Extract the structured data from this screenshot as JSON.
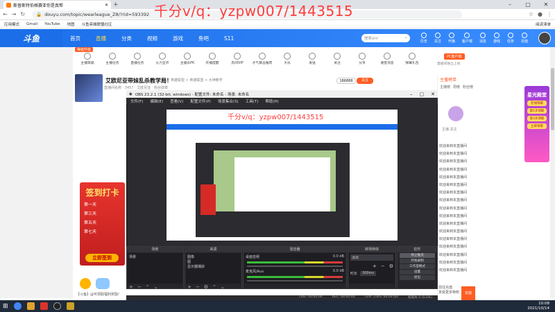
{
  "browser": {
    "tab_title": "斯普斯特伯格赛亚你是真帮",
    "url": "douyu.com/topic/wearleague_Z8/?rid=593392",
    "bookmarks": [
      "应用模式",
      "Gmail",
      "YouTube",
      "地图",
      "斗鱼英雄联盟社区"
    ],
    "bookmarks_right": "阅读清单"
  },
  "watermark": "千分v/q：yzpw007/1443515",
  "douyu_nav": {
    "logo": "斗鱼",
    "items": [
      "首页",
      "直播",
      "分类",
      "视频",
      "游戏",
      "鱼吧",
      "S11"
    ],
    "active_index": 1,
    "search_placeholder": "搜索dnf",
    "top_icons": [
      "历史",
      "关注",
      "开播",
      "客户端",
      "消息",
      "游戏",
      "任务",
      "充值"
    ]
  },
  "player_row": {
    "level_badge": "等级升级",
    "items": [
      "主播等级",
      "主播任务",
      "直播任务",
      "火力全开",
      "主播乐PK",
      "开播提醒",
      "房间VIP",
      "才气暴击推荐",
      "大乐",
      "发送",
      "关注",
      "分享",
      "语音消息",
      "弹幕礼包",
      "更多动态"
    ],
    "pc_button": "PC客户端",
    "pc_sub": "直播间独立上线"
  },
  "room": {
    "title": "艾欧尼亚带妹乱杀教学局！",
    "subtitle": "英雄联盟 > 英雄联盟 > 大神教学",
    "subtitle2": "直播间名称 · 3457 · 艾欧尼亚 · 粉丝勋章",
    "fans": "186888",
    "follow": "关注"
  },
  "right_panel": {
    "header": "主播榜单",
    "tabs": [
      "主播榜",
      "周榜",
      "粉丝榜"
    ],
    "host_caption": "主播 关注",
    "chat": [
      "欢迎来到本直播间",
      "欢迎来到本直播间",
      "欢迎来到本直播间",
      "欢迎来到本直播间",
      "欢迎来到本直播间",
      "欢迎来到本直播间",
      "欢迎来到本直播间",
      "欢迎来到本直播间",
      "欢迎来到本直播间",
      "欢迎来到本直播间",
      "欢迎来到本直播间",
      "欢迎来到本直播间",
      "欢迎来到本直播间",
      "欢迎来到本直播间",
      "欢迎来到本直播间",
      "欢迎来到本直播间",
      "欢迎来到本直播间"
    ],
    "bottom_text": [
      "前往充值",
      "享受更多特权"
    ],
    "bottom_button": "充值"
  },
  "left_ad": {
    "title": "签到打卡",
    "days": [
      "第一天",
      "第三天",
      "第五天",
      "第七天"
    ],
    "button": "立即签到"
  },
  "side_ad": {
    "title": "星光殿堂",
    "items": [
      "在线领取",
      "第1天领取",
      "第3天领取",
      "立即领取"
    ]
  },
  "obs": {
    "title": "OBS 23.2.1 (32-bit, windows) - 配置文件: 未命名 - 场景: 未命名",
    "menu": [
      "文件(F)",
      "编辑(E)",
      "查看(V)",
      "配置文件(P)",
      "场景集合(S)",
      "工具(T)",
      "帮助(H)"
    ],
    "docks": {
      "scenes": {
        "title": "场景",
        "items": [
          "场景"
        ]
      },
      "sources": {
        "title": "来源",
        "items": [
          "图像",
          "图",
          "显示器捕获"
        ]
      },
      "mixer": {
        "title": "混音器",
        "tracks": [
          {
            "name": "桌面音频",
            "level": "0.0 dB"
          },
          {
            "name": "麦克风/Aux",
            "level": "0.0 dB"
          }
        ]
      },
      "transitions": {
        "title": "转场特效",
        "type": "淡出",
        "duration_label": "时长",
        "duration": "300ms"
      },
      "controls": {
        "title": "控件",
        "buttons": [
          "停止推流",
          "开始录制",
          "工作室模式",
          "设置",
          "退出"
        ]
      }
    },
    "status": [
      "LIVE: 00:00:00",
      "REC: 00:00:00",
      "CPU: 3.8%, 60.00 fps",
      "帧丢失 0 (0.0%)"
    ]
  },
  "bottom_left": {
    "text": "【斗鱼】@可领取福利奖励!"
  },
  "taskbar": {
    "time": "10:08",
    "date": "2021/10/14"
  }
}
